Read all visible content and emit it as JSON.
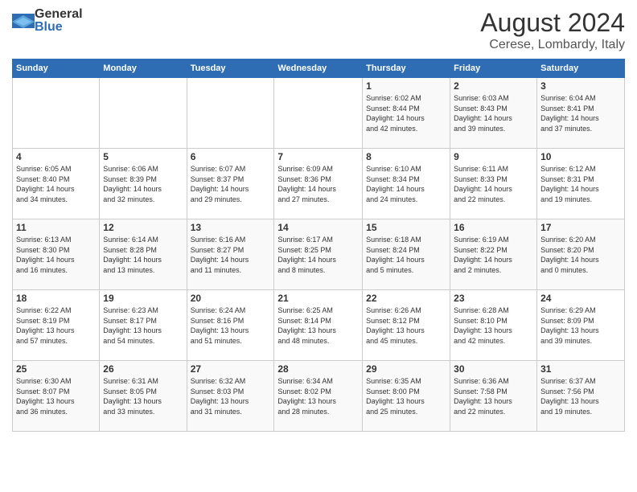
{
  "header": {
    "logo_general": "General",
    "logo_blue": "Blue",
    "main_title": "August 2024",
    "subtitle": "Cerese, Lombardy, Italy"
  },
  "calendar": {
    "days_of_week": [
      "Sunday",
      "Monday",
      "Tuesday",
      "Wednesday",
      "Thursday",
      "Friday",
      "Saturday"
    ],
    "weeks": [
      [
        {
          "day": "",
          "info": ""
        },
        {
          "day": "",
          "info": ""
        },
        {
          "day": "",
          "info": ""
        },
        {
          "day": "",
          "info": ""
        },
        {
          "day": "1",
          "info": "Sunrise: 6:02 AM\nSunset: 8:44 PM\nDaylight: 14 hours\nand 42 minutes."
        },
        {
          "day": "2",
          "info": "Sunrise: 6:03 AM\nSunset: 8:43 PM\nDaylight: 14 hours\nand 39 minutes."
        },
        {
          "day": "3",
          "info": "Sunrise: 6:04 AM\nSunset: 8:41 PM\nDaylight: 14 hours\nand 37 minutes."
        }
      ],
      [
        {
          "day": "4",
          "info": "Sunrise: 6:05 AM\nSunset: 8:40 PM\nDaylight: 14 hours\nand 34 minutes."
        },
        {
          "day": "5",
          "info": "Sunrise: 6:06 AM\nSunset: 8:39 PM\nDaylight: 14 hours\nand 32 minutes."
        },
        {
          "day": "6",
          "info": "Sunrise: 6:07 AM\nSunset: 8:37 PM\nDaylight: 14 hours\nand 29 minutes."
        },
        {
          "day": "7",
          "info": "Sunrise: 6:09 AM\nSunset: 8:36 PM\nDaylight: 14 hours\nand 27 minutes."
        },
        {
          "day": "8",
          "info": "Sunrise: 6:10 AM\nSunset: 8:34 PM\nDaylight: 14 hours\nand 24 minutes."
        },
        {
          "day": "9",
          "info": "Sunrise: 6:11 AM\nSunset: 8:33 PM\nDaylight: 14 hours\nand 22 minutes."
        },
        {
          "day": "10",
          "info": "Sunrise: 6:12 AM\nSunset: 8:31 PM\nDaylight: 14 hours\nand 19 minutes."
        }
      ],
      [
        {
          "day": "11",
          "info": "Sunrise: 6:13 AM\nSunset: 8:30 PM\nDaylight: 14 hours\nand 16 minutes."
        },
        {
          "day": "12",
          "info": "Sunrise: 6:14 AM\nSunset: 8:28 PM\nDaylight: 14 hours\nand 13 minutes."
        },
        {
          "day": "13",
          "info": "Sunrise: 6:16 AM\nSunset: 8:27 PM\nDaylight: 14 hours\nand 11 minutes."
        },
        {
          "day": "14",
          "info": "Sunrise: 6:17 AM\nSunset: 8:25 PM\nDaylight: 14 hours\nand 8 minutes."
        },
        {
          "day": "15",
          "info": "Sunrise: 6:18 AM\nSunset: 8:24 PM\nDaylight: 14 hours\nand 5 minutes."
        },
        {
          "day": "16",
          "info": "Sunrise: 6:19 AM\nSunset: 8:22 PM\nDaylight: 14 hours\nand 2 minutes."
        },
        {
          "day": "17",
          "info": "Sunrise: 6:20 AM\nSunset: 8:20 PM\nDaylight: 14 hours\nand 0 minutes."
        }
      ],
      [
        {
          "day": "18",
          "info": "Sunrise: 6:22 AM\nSunset: 8:19 PM\nDaylight: 13 hours\nand 57 minutes."
        },
        {
          "day": "19",
          "info": "Sunrise: 6:23 AM\nSunset: 8:17 PM\nDaylight: 13 hours\nand 54 minutes."
        },
        {
          "day": "20",
          "info": "Sunrise: 6:24 AM\nSunset: 8:16 PM\nDaylight: 13 hours\nand 51 minutes."
        },
        {
          "day": "21",
          "info": "Sunrise: 6:25 AM\nSunset: 8:14 PM\nDaylight: 13 hours\nand 48 minutes."
        },
        {
          "day": "22",
          "info": "Sunrise: 6:26 AM\nSunset: 8:12 PM\nDaylight: 13 hours\nand 45 minutes."
        },
        {
          "day": "23",
          "info": "Sunrise: 6:28 AM\nSunset: 8:10 PM\nDaylight: 13 hours\nand 42 minutes."
        },
        {
          "day": "24",
          "info": "Sunrise: 6:29 AM\nSunset: 8:09 PM\nDaylight: 13 hours\nand 39 minutes."
        }
      ],
      [
        {
          "day": "25",
          "info": "Sunrise: 6:30 AM\nSunset: 8:07 PM\nDaylight: 13 hours\nand 36 minutes."
        },
        {
          "day": "26",
          "info": "Sunrise: 6:31 AM\nSunset: 8:05 PM\nDaylight: 13 hours\nand 33 minutes."
        },
        {
          "day": "27",
          "info": "Sunrise: 6:32 AM\nSunset: 8:03 PM\nDaylight: 13 hours\nand 31 minutes."
        },
        {
          "day": "28",
          "info": "Sunrise: 6:34 AM\nSunset: 8:02 PM\nDaylight: 13 hours\nand 28 minutes."
        },
        {
          "day": "29",
          "info": "Sunrise: 6:35 AM\nSunset: 8:00 PM\nDaylight: 13 hours\nand 25 minutes."
        },
        {
          "day": "30",
          "info": "Sunrise: 6:36 AM\nSunset: 7:58 PM\nDaylight: 13 hours\nand 22 minutes."
        },
        {
          "day": "31",
          "info": "Sunrise: 6:37 AM\nSunset: 7:56 PM\nDaylight: 13 hours\nand 19 minutes."
        }
      ]
    ]
  }
}
